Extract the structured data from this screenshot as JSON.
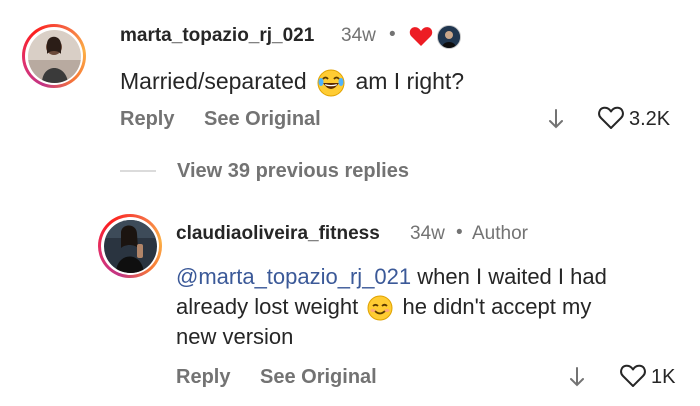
{
  "comment1": {
    "username": "marta_topazio_rj_021",
    "time": "34w",
    "text_before": "Married/separated",
    "text_after": "am I right?",
    "reply_label": "Reply",
    "see_original_label": "See Original",
    "likes": "3.2K"
  },
  "view_replies": {
    "label": "View 39 previous replies"
  },
  "comment2": {
    "username": "claudiaoliveira_fitness",
    "time": "34w",
    "author_badge": "Author",
    "mention": "@marta_topazio_rj_021",
    "line1_rest": "when I waited I had",
    "line2_before": "already lost weight",
    "line2_after": "he didn't accept my",
    "line3": "new version",
    "reply_label": "Reply",
    "see_original_label": "See Original",
    "likes": "1K"
  },
  "colors": {
    "heart": "#ed1c24",
    "link": "#3b5998",
    "meta": "#737373"
  },
  "icons": [
    "heart-icon",
    "avatar-badge-icon",
    "laughing-emoji-icon",
    "smiling-emoji-icon",
    "translate-arrow-icon",
    "like-heart-icon"
  ]
}
